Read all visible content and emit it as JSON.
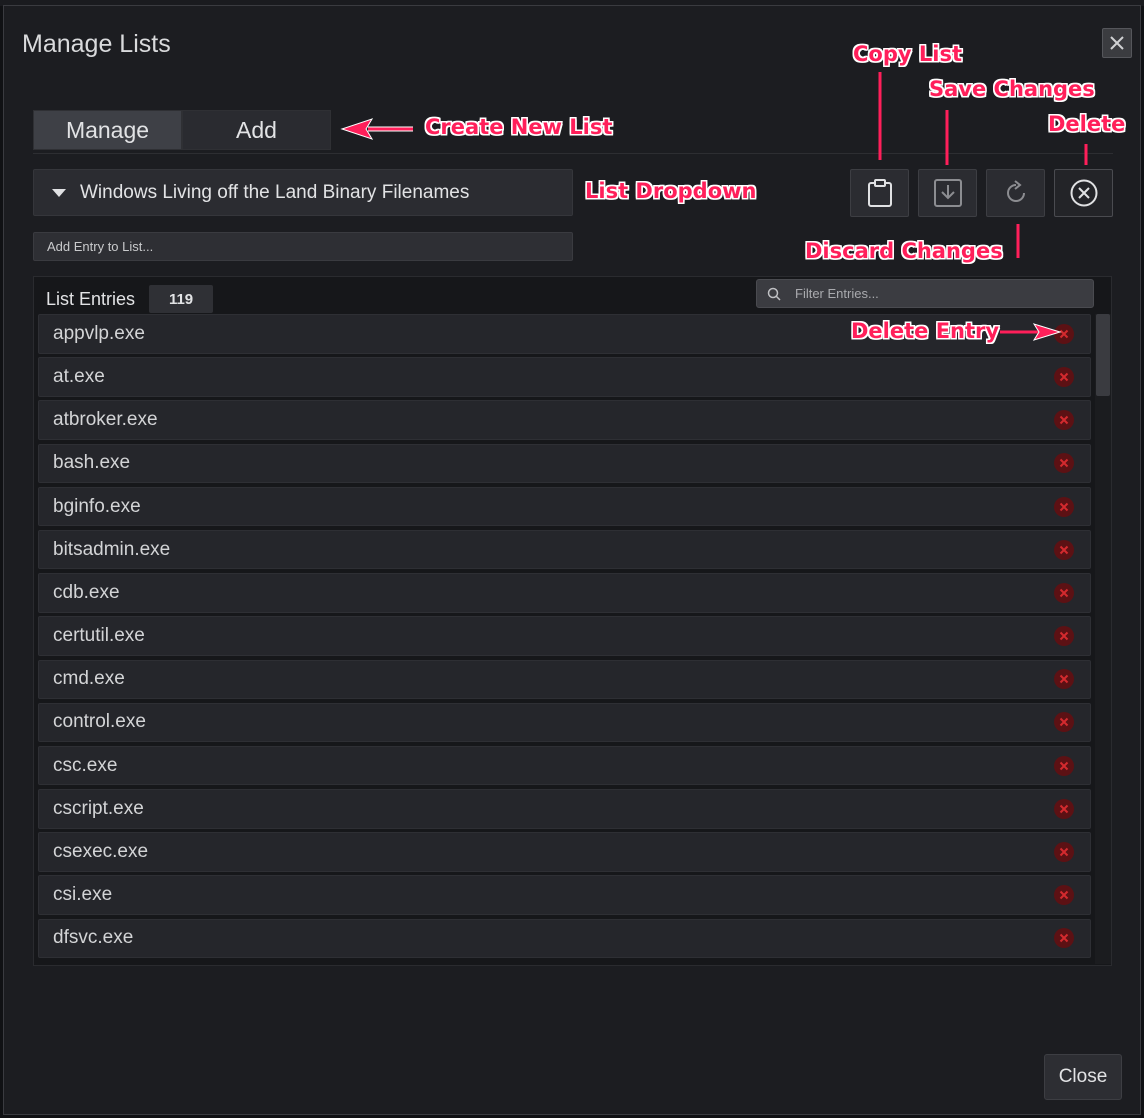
{
  "dialog": {
    "title": "Manage Lists",
    "close_label": "Close"
  },
  "tabs": [
    {
      "label": "Manage",
      "active": true
    },
    {
      "label": "Add",
      "active": false
    }
  ],
  "list_dropdown": {
    "selected": "Windows Living off the Land Binary Filenames"
  },
  "add_entry": {
    "placeholder": "Add Entry to List..."
  },
  "toolbar": [
    {
      "icon": "clipboard-icon",
      "action": "Copy List"
    },
    {
      "icon": "save-download-icon",
      "action": "Save Changes"
    },
    {
      "icon": "refresh-icon",
      "action": "Discard Changes"
    },
    {
      "icon": "circle-x-icon",
      "action": "Delete"
    }
  ],
  "entries_panel": {
    "label": "List Entries",
    "count": "119",
    "filter_placeholder": "Filter Entries..."
  },
  "entries": [
    "appvlp.exe",
    "at.exe",
    "atbroker.exe",
    "bash.exe",
    "bginfo.exe",
    "bitsadmin.exe",
    "cdb.exe",
    "certutil.exe",
    "cmd.exe",
    "control.exe",
    "csc.exe",
    "cscript.exe",
    "csexec.exe",
    "csi.exe",
    "dfsvc.exe"
  ],
  "annotations": {
    "create_new_list": "Create New List",
    "list_dropdown": "List Dropdown",
    "copy_list": "Copy List",
    "save_changes": "Save Changes",
    "delete": "Delete",
    "discard_changes": "Discard Changes",
    "delete_entry": "Delete Entry"
  },
  "colors": {
    "annotation": "#ff1f5a",
    "delete_circle": "#5c1114",
    "delete_x": "#d42a2e"
  }
}
